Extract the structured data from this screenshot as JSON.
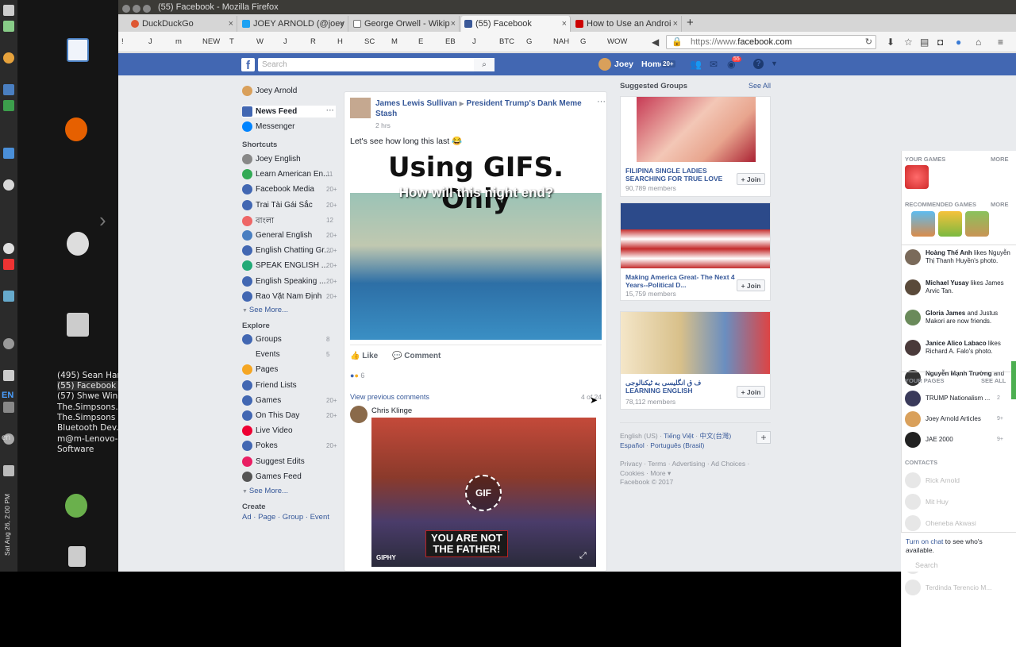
{
  "desktop": {
    "tasks": [
      "(495) Sean Han...",
      "(55) Facebook -...",
      "(57) Shwe Win ...",
      "The.Simpsons....",
      "The.Simpsons ...",
      "Bluetooth Dev...",
      "m@m-Lenovo-...",
      "Software"
    ],
    "tray": {
      "lang": "EN",
      "lang2": "en",
      "datetime": "Sat Aug 26, 2:00 PM"
    }
  },
  "browser": {
    "title": "(55) Facebook - Mozilla Firefox",
    "tabs": [
      "DuckDuckGo",
      "JOEY ARNOLD (@joey",
      "George Orwell - Wikip",
      "(55) Facebook",
      "How to Use an Androi"
    ],
    "new_tab": "+",
    "bookmarks": [
      "!",
      "J",
      "m",
      "NEW",
      "T",
      "W",
      "J",
      "R",
      "H",
      "SC",
      "M",
      "E",
      "EB",
      "J",
      "BTC",
      "G",
      "NAH",
      "G",
      "WOW"
    ],
    "url_prefix": "https://www.",
    "url_domain": "facebook.com"
  },
  "fb": {
    "search_placeholder": "Search",
    "user": "Joey",
    "home": "Home",
    "home_count": "20+",
    "notif_count": "55",
    "left": {
      "profile": "Joey Arnold",
      "news_feed": "News Feed",
      "messenger": "Messenger",
      "shortcuts_h": "Shortcuts",
      "shortcuts": [
        {
          "label": "Joey English",
          "count": ""
        },
        {
          "label": "Learn American En...",
          "count": "11"
        },
        {
          "label": "Facebook Media",
          "count": "20+"
        },
        {
          "label": "Trai Tài Gái Sắc",
          "count": "20+"
        },
        {
          "label": "বাংলা",
          "count": "12"
        },
        {
          "label": "General English",
          "count": "20+"
        },
        {
          "label": "English Chatting Gr...",
          "count": "20+"
        },
        {
          "label": "SPEAK ENGLISH ...",
          "count": "20+"
        },
        {
          "label": "English Speaking ...",
          "count": "20+"
        },
        {
          "label": "Rao Vặt Nam Định",
          "count": "20+"
        }
      ],
      "see_more": "See More...",
      "explore_h": "Explore",
      "explore": [
        {
          "label": "Groups",
          "count": "8"
        },
        {
          "label": "Events",
          "count": "5"
        },
        {
          "label": "Pages",
          "count": ""
        },
        {
          "label": "Friend Lists",
          "count": ""
        },
        {
          "label": "Games",
          "count": "20+"
        },
        {
          "label": "On This Day",
          "count": "20+"
        },
        {
          "label": "Live Video",
          "count": ""
        },
        {
          "label": "Pokes",
          "count": "20+"
        },
        {
          "label": "Suggest Edits",
          "count": ""
        },
        {
          "label": "Games Feed",
          "count": ""
        }
      ],
      "see_more2": "See More...",
      "create_h": "Create",
      "create": [
        "Ad",
        "Page",
        "Group",
        "Event"
      ]
    },
    "post": {
      "author": "James Lewis Sullivan",
      "arrow": "▶",
      "group": "President Trump's Dank Meme Stash",
      "time": "2 hrs",
      "text": "Let's see how long this last 😂",
      "meme_line1": "Using GIFS. Only",
      "meme_line2": "How will this night end?",
      "like": "Like",
      "comment": "Comment",
      "reactions": "6",
      "view_prev": "View previous comments",
      "comment_count": "4 of 24",
      "commenter": "Chris Klinge",
      "gif_label": "GIF",
      "gif_caption1": "YOU ARE NOT",
      "gif_caption2": "THE FATHER!",
      "giphy": "GIPHY"
    },
    "groups": {
      "heading": "Suggested Groups",
      "see_all": "See All",
      "items": [
        {
          "name": "FILIPINA SINGLE LADIES SEARCHING FOR TRUE LOVE",
          "members": "90,789 members"
        },
        {
          "name": "Making America Great- The Next 4 Years--Political D...",
          "members": "15,759 members"
        },
        {
          "name": "ف ق انگلیسی به ٹیکنالوجی LEARNING ENGLISH",
          "members": "78,112 members"
        }
      ],
      "join": "+ Join"
    },
    "footer": {
      "lang_current": "English (US)",
      "langs": [
        "Tiếng Việt",
        "中文(台灣)",
        "Español",
        "Português (Brasil)"
      ],
      "links": "Privacy · Terms · Advertising · Ad Choices · Cookies · More ▾",
      "copyright": "Facebook © 2017"
    },
    "ticker": {
      "your_games": "YOUR GAMES",
      "more": "MORE",
      "recommended": "RECOMMENDED GAMES",
      "activity": [
        {
          "name": "Hoàng Thế Anh",
          "text": " likes Nguyễn Thị Thanh Huyền's photo."
        },
        {
          "name": "Michael Yusay",
          "text": " likes James Arvic Tan."
        },
        {
          "name": "Gloria James",
          "text": " and Justus Makori are now friends."
        },
        {
          "name": "Janice Alico Labaco",
          "text": " likes Richard A. Falo's photo."
        },
        {
          "name": "Nguyễn Mạnh Trường",
          "text": " and"
        }
      ],
      "your_pages": "YOUR PAGES",
      "see_all": "SEE ALL",
      "pages": [
        {
          "name": "TRUMP Nationalism ...",
          "count": "2"
        },
        {
          "name": "Joey Arnold Articles",
          "count": "9+"
        },
        {
          "name": "JAE 2000",
          "count": "9+"
        }
      ],
      "contacts_h": "CONTACTS",
      "contacts": [
        "Rick Arnold",
        "Mit Huy",
        "Oheneba Akwasi",
        "Bất Động Sản VT",
        "U Hlet Lin Ko",
        "Terdinda Terencio M..."
      ],
      "turn_on": "Turn on chat",
      "turn_on_rest": " to see who's available.",
      "search": "Search"
    }
  }
}
